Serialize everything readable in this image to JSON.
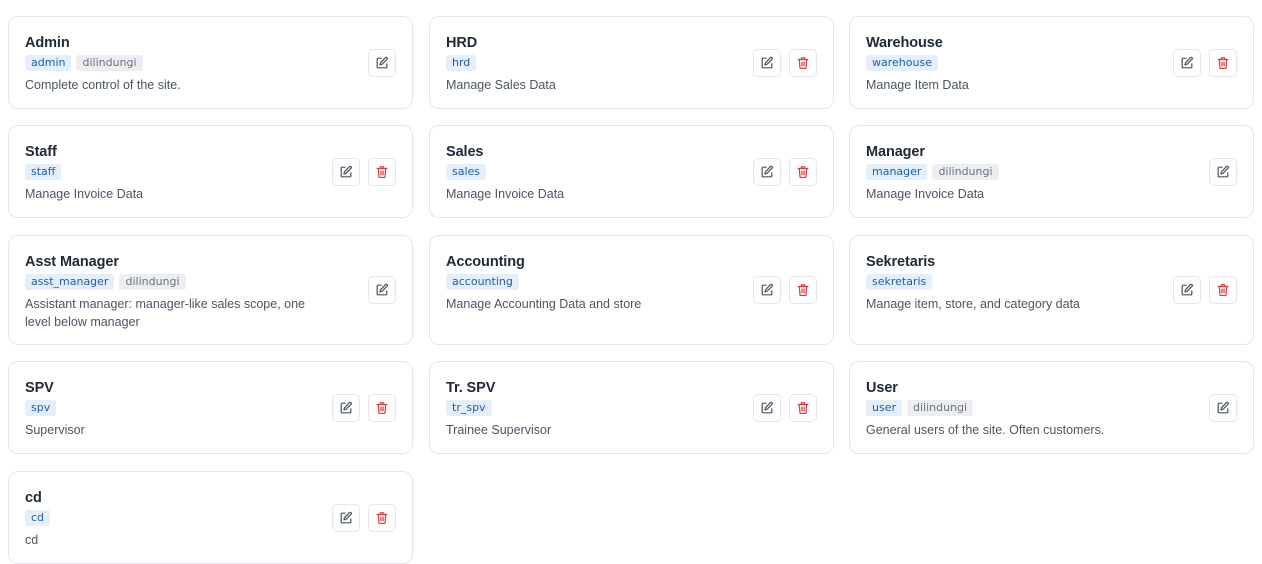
{
  "roles": [
    {
      "name": "Admin",
      "slug": "admin",
      "protected_label": "dilindungi",
      "description": "Complete control of the site.",
      "deletable": false
    },
    {
      "name": "HRD",
      "slug": "hrd",
      "protected_label": "",
      "description": "Manage Sales Data",
      "deletable": true
    },
    {
      "name": "Warehouse",
      "slug": "warehouse",
      "protected_label": "",
      "description": "Manage Item Data",
      "deletable": true
    },
    {
      "name": "Staff",
      "slug": "staff",
      "protected_label": "",
      "description": "Manage Invoice Data",
      "deletable": true
    },
    {
      "name": "Sales",
      "slug": "sales",
      "protected_label": "",
      "description": "Manage Invoice Data",
      "deletable": true
    },
    {
      "name": "Manager",
      "slug": "manager",
      "protected_label": "dilindungi",
      "description": "Manage Invoice Data",
      "deletable": false
    },
    {
      "name": "Asst Manager",
      "slug": "asst_manager",
      "protected_label": "dilindungi",
      "description": "Assistant manager: manager-like sales scope, one level below manager",
      "deletable": false
    },
    {
      "name": "Accounting",
      "slug": "accounting",
      "protected_label": "",
      "description": "Manage Accounting Data and store",
      "deletable": true
    },
    {
      "name": "Sekretaris",
      "slug": "sekretaris",
      "protected_label": "",
      "description": "Manage item, store, and category data",
      "deletable": true
    },
    {
      "name": "SPV",
      "slug": "spv",
      "protected_label": "",
      "description": "Supervisor",
      "deletable": true
    },
    {
      "name": "Tr. SPV",
      "slug": "tr_spv",
      "protected_label": "",
      "description": "Trainee Supervisor",
      "deletable": true
    },
    {
      "name": "User",
      "slug": "user",
      "protected_label": "dilindungi",
      "description": "General users of the site. Often customers.",
      "deletable": false
    },
    {
      "name": "cd",
      "slug": "cd",
      "protected_label": "",
      "description": "cd",
      "deletable": true
    }
  ],
  "icons": {
    "edit": "pencil-square-icon",
    "delete": "trash-icon"
  },
  "colors": {
    "slug_badge_bg": "#e4effb",
    "slug_badge_text": "#1d5fa8",
    "protected_badge_bg": "#eceef1",
    "delete_icon": "#dc3b3b",
    "edit_icon": "#4b5563"
  }
}
